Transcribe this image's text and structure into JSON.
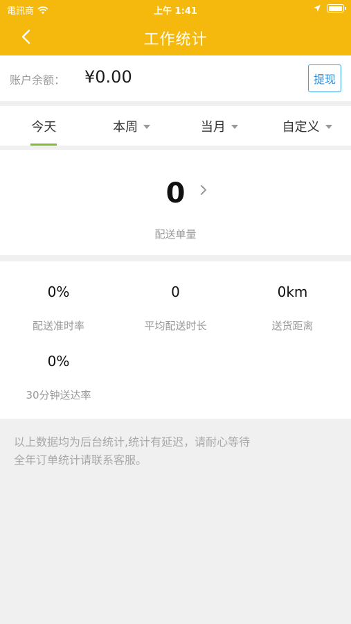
{
  "status_bar": {
    "carrier": "電訊商",
    "time": "上午 1:41"
  },
  "nav": {
    "title": "工作统计",
    "back_icon": "chevron-left-icon",
    "background_color": "#f5b80d"
  },
  "balance": {
    "label": "账户余额：",
    "value": "¥0.00",
    "withdraw_label": "提现"
  },
  "tabs": [
    {
      "label": "今天",
      "active": true,
      "has_dropdown": false
    },
    {
      "label": "本周",
      "active": false,
      "has_dropdown": true
    },
    {
      "label": "当月",
      "active": false,
      "has_dropdown": true
    },
    {
      "label": "自定义",
      "active": false,
      "has_dropdown": true
    }
  ],
  "delivery_count": {
    "value": "0",
    "label": "配送单量"
  },
  "metrics": [
    {
      "value": "0%",
      "label": "配送准时率"
    },
    {
      "value": "0",
      "label": "平均配送时长"
    },
    {
      "value": "0km",
      "label": "送货距离"
    },
    {
      "value": "0%",
      "label": "30分钟送达率"
    }
  ],
  "notice": {
    "line1": "以上数据均为后台统计,统计有延迟，请耐心等待",
    "line2": "全年订单统计请联系客服。"
  }
}
